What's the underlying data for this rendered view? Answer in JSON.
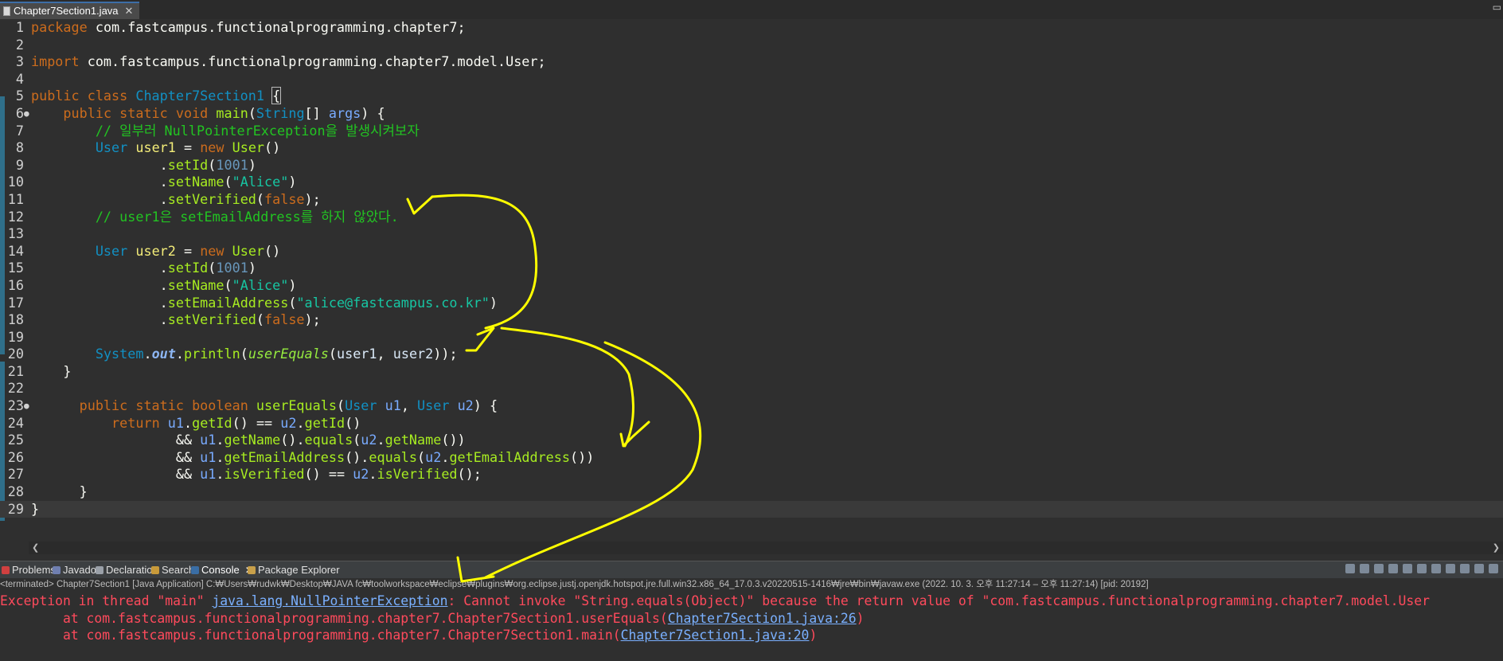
{
  "editor_tab": {
    "title": "Chapter7Section1.java",
    "close": "✕"
  },
  "code": {
    "lines": [
      {
        "n": "1",
        "parts": [
          [
            "kw",
            "package"
          ],
          [
            "pl",
            " com.fastcampus.functionalprogramming.chapter7;"
          ]
        ]
      },
      {
        "n": "2",
        "parts": []
      },
      {
        "n": "3",
        "parts": [
          [
            "kw",
            "import"
          ],
          [
            "pl",
            " com.fastcampus.functionalprogramming.chapter7.model.User;"
          ]
        ]
      },
      {
        "n": "4",
        "parts": []
      },
      {
        "n": "5",
        "parts": [
          [
            "kw",
            "public class "
          ],
          [
            "cl",
            "Chapter7Section1"
          ],
          [
            "pl",
            " "
          ],
          [
            "cursor",
            "{"
          ]
        ]
      },
      {
        "n": "6",
        "fold": "●",
        "parts": [
          [
            "pl",
            "    "
          ],
          [
            "kw",
            "public static void "
          ],
          [
            "fn",
            "main"
          ],
          [
            "pl",
            "("
          ],
          [
            "ty",
            "String"
          ],
          [
            "pl",
            "[] "
          ],
          [
            "pm",
            "args"
          ],
          [
            "pl",
            ") {"
          ]
        ]
      },
      {
        "n": "7",
        "parts": [
          [
            "pl",
            "        "
          ],
          [
            "cm",
            "// 일부러 NullPointerException을 발생시켜보자"
          ]
        ]
      },
      {
        "n": "8",
        "parts": [
          [
            "pl",
            "        "
          ],
          [
            "ty",
            "User "
          ],
          [
            "vr",
            "user1"
          ],
          [
            "pl",
            " = "
          ],
          [
            "kw",
            "new "
          ],
          [
            "fn",
            "User"
          ],
          [
            "pl",
            "()"
          ]
        ]
      },
      {
        "n": "9",
        "parts": [
          [
            "pl",
            "                ."
          ],
          [
            "fn",
            "setId"
          ],
          [
            "pl",
            "("
          ],
          [
            "num",
            "1001"
          ],
          [
            "pl",
            ")"
          ]
        ]
      },
      {
        "n": "10",
        "parts": [
          [
            "pl",
            "                ."
          ],
          [
            "fn",
            "setName"
          ],
          [
            "pl",
            "("
          ],
          [
            "str",
            "\"Alice\""
          ],
          [
            "pl",
            ")"
          ]
        ]
      },
      {
        "n": "11",
        "parts": [
          [
            "pl",
            "                ."
          ],
          [
            "fn",
            "setVerified"
          ],
          [
            "pl",
            "("
          ],
          [
            "kw",
            "false"
          ],
          [
            "pl",
            ");"
          ]
        ]
      },
      {
        "n": "12",
        "parts": [
          [
            "pl",
            "        "
          ],
          [
            "cm",
            "// user1은 setEmailAddress를 하지 않았다."
          ]
        ]
      },
      {
        "n": "13",
        "parts": []
      },
      {
        "n": "14",
        "parts": [
          [
            "pl",
            "        "
          ],
          [
            "ty",
            "User "
          ],
          [
            "vr",
            "user2"
          ],
          [
            "pl",
            " = "
          ],
          [
            "kw",
            "new "
          ],
          [
            "fn",
            "User"
          ],
          [
            "pl",
            "()"
          ]
        ]
      },
      {
        "n": "15",
        "parts": [
          [
            "pl",
            "                ."
          ],
          [
            "fn",
            "setId"
          ],
          [
            "pl",
            "("
          ],
          [
            "num",
            "1001"
          ],
          [
            "pl",
            ")"
          ]
        ]
      },
      {
        "n": "16",
        "parts": [
          [
            "pl",
            "                ."
          ],
          [
            "fn",
            "setName"
          ],
          [
            "pl",
            "("
          ],
          [
            "str",
            "\"Alice\""
          ],
          [
            "pl",
            ")"
          ]
        ]
      },
      {
        "n": "17",
        "parts": [
          [
            "pl",
            "                ."
          ],
          [
            "fn",
            "setEmailAddress"
          ],
          [
            "pl",
            "("
          ],
          [
            "str",
            "\"alice@fastcampus.co.kr\""
          ],
          [
            "pl",
            ")"
          ]
        ]
      },
      {
        "n": "18",
        "parts": [
          [
            "pl",
            "                ."
          ],
          [
            "fn",
            "setVerified"
          ],
          [
            "pl",
            "("
          ],
          [
            "kw",
            "false"
          ],
          [
            "pl",
            ");"
          ]
        ]
      },
      {
        "n": "19",
        "parts": []
      },
      {
        "n": "20",
        "parts": [
          [
            "pl",
            "        "
          ],
          [
            "ty",
            "System"
          ],
          [
            "pl",
            "."
          ],
          [
            "st",
            "out"
          ],
          [
            "pl",
            "."
          ],
          [
            "fn",
            "println"
          ],
          [
            "pl",
            "("
          ],
          [
            "it",
            "userEquals"
          ],
          [
            "pl",
            "("
          ],
          [
            "hs",
            "user1"
          ],
          [
            "pl",
            ", "
          ],
          [
            "hs",
            "user2"
          ],
          [
            "pl",
            "));"
          ]
        ]
      },
      {
        "n": "21",
        "parts": [
          [
            "pl",
            "    }"
          ]
        ]
      },
      {
        "n": "22",
        "parts": []
      },
      {
        "n": "23",
        "fold": "●",
        "parts": [
          [
            "pl",
            "      "
          ],
          [
            "kw",
            "public static boolean "
          ],
          [
            "fn",
            "userEquals"
          ],
          [
            "pl",
            "("
          ],
          [
            "ty",
            "User "
          ],
          [
            "pm",
            "u1"
          ],
          [
            "pl",
            ", "
          ],
          [
            "ty",
            "User "
          ],
          [
            "pm",
            "u2"
          ],
          [
            "pl",
            ") {"
          ]
        ]
      },
      {
        "n": "24",
        "parts": [
          [
            "pl",
            "          "
          ],
          [
            "kw",
            "return "
          ],
          [
            "pm",
            "u1"
          ],
          [
            "pl",
            "."
          ],
          [
            "fn",
            "getId"
          ],
          [
            "pl",
            "() == "
          ],
          [
            "pm",
            "u2"
          ],
          [
            "pl",
            "."
          ],
          [
            "fn",
            "getId"
          ],
          [
            "pl",
            "()"
          ]
        ]
      },
      {
        "n": "25",
        "parts": [
          [
            "pl",
            "                  && "
          ],
          [
            "pm",
            "u1"
          ],
          [
            "pl",
            "."
          ],
          [
            "fn",
            "getName"
          ],
          [
            "pl",
            "()."
          ],
          [
            "fn",
            "equals"
          ],
          [
            "pl",
            "("
          ],
          [
            "pm",
            "u2"
          ],
          [
            "pl",
            "."
          ],
          [
            "fn",
            "getName"
          ],
          [
            "pl",
            "())"
          ]
        ]
      },
      {
        "n": "26",
        "parts": [
          [
            "pl",
            "                  && "
          ],
          [
            "pm",
            "u1"
          ],
          [
            "pl",
            "."
          ],
          [
            "fn",
            "getEmailAddress"
          ],
          [
            "pl",
            "()."
          ],
          [
            "fn",
            "equals"
          ],
          [
            "pl",
            "("
          ],
          [
            "pm",
            "u2"
          ],
          [
            "pl",
            "."
          ],
          [
            "fn",
            "getEmailAddress"
          ],
          [
            "pl",
            "())"
          ]
        ]
      },
      {
        "n": "27",
        "parts": [
          [
            "pl",
            "                  && "
          ],
          [
            "pm",
            "u1"
          ],
          [
            "pl",
            "."
          ],
          [
            "fn",
            "isVerified"
          ],
          [
            "pl",
            "() == "
          ],
          [
            "pm",
            "u2"
          ],
          [
            "pl",
            "."
          ],
          [
            "fn",
            "isVerified"
          ],
          [
            "pl",
            "();"
          ]
        ]
      },
      {
        "n": "28",
        "parts": [
          [
            "pl",
            "      }"
          ]
        ]
      },
      {
        "n": "29",
        "current": true,
        "parts": [
          [
            "pl",
            "}"
          ]
        ]
      }
    ]
  },
  "panel": {
    "tabs": [
      {
        "label": "Problems",
        "icon": "problems-icon",
        "color": "#d04040"
      },
      {
        "label": "Javadoc",
        "icon": "javadoc-icon",
        "color": "#6f7fb0"
      },
      {
        "label": "Declaration",
        "icon": "declaration-icon",
        "color": "#9aa0a8"
      },
      {
        "label": "Search",
        "icon": "search-icon",
        "color": "#c89a3a"
      },
      {
        "label": "Console",
        "icon": "console-icon",
        "color": "#3a6ea5",
        "active": true
      },
      {
        "label": "Package Explorer",
        "icon": "package-explorer-icon",
        "color": "#c8a04a"
      }
    ],
    "console_close": "✕",
    "status": "<terminated> Chapter7Section1 [Java Application] C:₩Users₩rudwk₩Desktop₩JAVA fc₩toolworkspace₩eclipse₩plugins₩org.eclipse.justj.openjdk.hotspot.jre.full.win32.x86_64_17.0.3.v20220515-1416₩jre₩bin₩javaw.exe  (2022. 10. 3. 오후 11:27:14 – 오후 11:27:14) [pid: 20192]"
  },
  "console": {
    "line1_a": "Exception in thread \"main\" ",
    "line1_link": "java.lang.NullPointerException",
    "line1_b": ": Cannot invoke \"String.equals(Object)\" because the return value of \"com.fastcampus.functionalprogramming.chapter7.model.User",
    "line2_a": "\tat com.fastcampus.functionalprogramming.chapter7.Chapter7Section1.userEquals(",
    "line2_link": "Chapter7Section1.java:26",
    "line2_b": ")",
    "line3_a": "\tat com.fastcampus.functionalprogramming.chapter7.Chapter7Section1.main(",
    "line3_link": "Chapter7Section1.java:20",
    "line3_b": ")"
  },
  "annotation_color": "#ffff00"
}
